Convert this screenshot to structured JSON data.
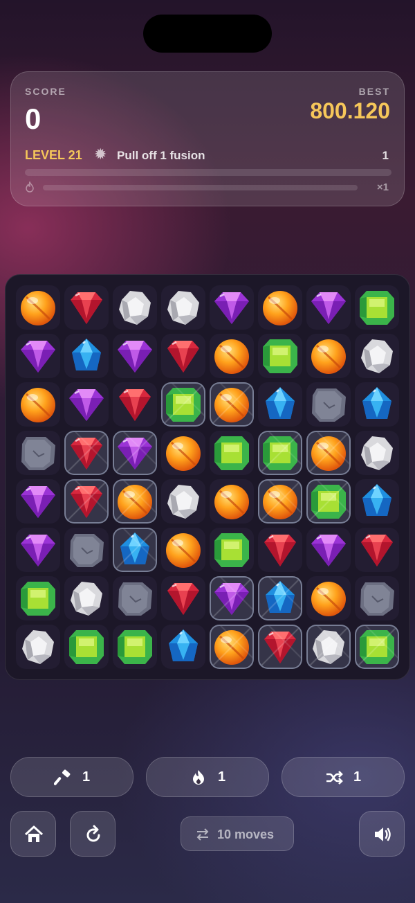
{
  "score_card": {
    "score_label": "SCORE",
    "score": "0",
    "best_label": "BEST",
    "best": "800.120",
    "level": "LEVEL 21",
    "objective_icon": "starburst-icon",
    "objective": "Pull off 1 fusion",
    "objective_count": "1",
    "objective_progress": 0,
    "combo_icon": "flame-icon",
    "combo_progress": 0,
    "multiplier": "×1"
  },
  "board": {
    "rows": [
      [
        "orange",
        "red",
        "white",
        "white",
        "purple",
        "orange",
        "purple",
        "green"
      ],
      [
        "purple",
        "blue",
        "purple",
        "red",
        "orange",
        "green",
        "orange",
        "white"
      ],
      [
        "orange",
        "purple",
        "red",
        "green*",
        "orange*",
        "blue",
        "rock",
        "blue"
      ],
      [
        "rock",
        "red*",
        "purple*",
        "orange",
        "green",
        "green*",
        "orange*",
        "white"
      ],
      [
        "purple",
        "red*",
        "orange*",
        "white",
        "orange",
        "orange*",
        "green*",
        "blue"
      ],
      [
        "purple",
        "rock",
        "blue*",
        "orange",
        "green",
        "red",
        "purple",
        "red"
      ],
      [
        "green",
        "white",
        "rock",
        "red",
        "purple*",
        "blue*",
        "orange",
        "rock"
      ],
      [
        "white",
        "green",
        "green",
        "blue",
        "orange*",
        "red*",
        "white*",
        "green*"
      ]
    ],
    "legend": "* = frozen (ice) tile"
  },
  "powerups": [
    {
      "icon": "hammer-icon",
      "count": "1"
    },
    {
      "icon": "flame-icon",
      "count": "1"
    },
    {
      "icon": "shuffle-icon",
      "count": "1"
    }
  ],
  "footer": {
    "home_icon": "home-icon",
    "restart_icon": "restart-icon",
    "moves_icon": "swap-arrows-icon",
    "moves": "10 moves",
    "sound_icon": "speaker-icon"
  },
  "colors": {
    "accent_gold": "#f6c75a",
    "card_bg": "rgba(255,255,255,0.13)",
    "board_bg": "#1c1728"
  }
}
